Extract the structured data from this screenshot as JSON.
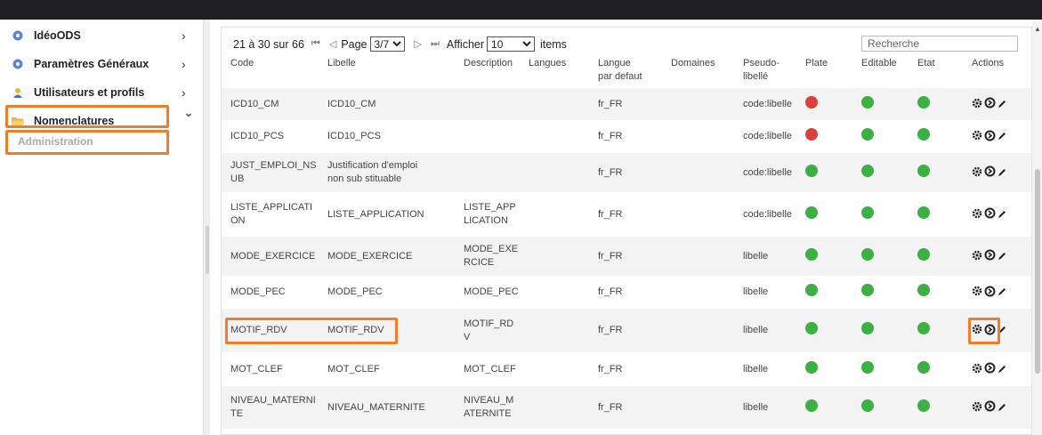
{
  "sidebar": {
    "items": [
      {
        "label": "IdéoODS",
        "icon": "gear-icon",
        "chevron": "›"
      },
      {
        "label": "Paramètres Généraux",
        "icon": "gear-icon",
        "chevron": "›"
      },
      {
        "label": "Utilisateurs et profils",
        "icon": "users-icon",
        "chevron": "›"
      },
      {
        "label": "Nomenclatures",
        "icon": "folder-icon",
        "chevron": "⌄"
      }
    ],
    "sub_item": "Administration"
  },
  "pager": {
    "range_text": "21 à 30 sur 66",
    "page_label": "Page",
    "page_value": "3/7",
    "show_label": "Afficher",
    "show_value": "10",
    "items_label": "items"
  },
  "search": {
    "placeholder": "Recherche"
  },
  "table": {
    "columns": [
      "Code",
      "Libelle",
      "Description",
      "Langues",
      "Langue par defaut",
      "Domaines",
      "Pseudo-libellé",
      "Plate",
      "Editable",
      "Etat",
      "Actions"
    ],
    "rows": [
      {
        "code": "ICD10_CM",
        "libelle": "ICD10_CM",
        "description": "",
        "langues": "",
        "langue_defaut": "fr_FR",
        "domaines": "",
        "pseudo": "code:libelle",
        "plate": "red",
        "editable": "green",
        "etat": "green"
      },
      {
        "code": "ICD10_PCS",
        "libelle": "ICD10_PCS",
        "description": "",
        "langues": "",
        "langue_defaut": "fr_FR",
        "domaines": "",
        "pseudo": "code:libelle",
        "plate": "red",
        "editable": "green",
        "etat": "green"
      },
      {
        "code": "JUST_EMPLOI_NS UB",
        "libelle": "Justification d'emploi non sub stituable",
        "description": "",
        "langues": "",
        "langue_defaut": "fr_FR",
        "domaines": "",
        "pseudo": "code:libelle",
        "plate": "green",
        "editable": "green",
        "etat": "green"
      },
      {
        "code": "LISTE_APPLICATI ON",
        "libelle": "LISTE_APPLICATION",
        "description": "LISTE_APP LICATION",
        "langues": "",
        "langue_defaut": "fr_FR",
        "domaines": "",
        "pseudo": "code:libelle",
        "plate": "green",
        "editable": "green",
        "etat": "green"
      },
      {
        "code": "MODE_EXERCICE",
        "libelle": "MODE_EXERCICE",
        "description": "MODE_EXE RCICE",
        "langues": "",
        "langue_defaut": "fr_FR",
        "domaines": "",
        "pseudo": "libelle",
        "plate": "green",
        "editable": "green",
        "etat": "green"
      },
      {
        "code": "MODE_PEC",
        "libelle": "MODE_PEC",
        "description": "MODE_PEC",
        "langues": "",
        "langue_defaut": "fr_FR",
        "domaines": "",
        "pseudo": "libelle",
        "plate": "green",
        "editable": "green",
        "etat": "green"
      },
      {
        "code": "MOTIF_RDV",
        "libelle": "MOTIF_RDV",
        "description": "MOTIF_RD V",
        "langues": "",
        "langue_defaut": "fr_FR",
        "domaines": "",
        "pseudo": "libelle",
        "plate": "green",
        "editable": "green",
        "etat": "green"
      },
      {
        "code": "MOT_CLEF",
        "libelle": "MOT_CLEF",
        "description": "MOT_CLEF",
        "langues": "",
        "langue_defaut": "fr_FR",
        "domaines": "",
        "pseudo": "libelle",
        "plate": "green",
        "editable": "green",
        "etat": "green"
      },
      {
        "code": "NIVEAU_MATERNI TE",
        "libelle": "NIVEAU_MATERNITE",
        "description": "NIVEAU_M ATERNITE",
        "langues": "",
        "langue_defaut": "fr_FR",
        "domaines": "",
        "pseudo": "libelle",
        "plate": "green",
        "editable": "green",
        "etat": "green"
      }
    ],
    "actions": [
      "gear-icon",
      "arrow-circle-icon",
      "pencil-icon"
    ]
  },
  "colors": {
    "highlight": "#f07d2a",
    "status_green": "#3cb043",
    "status_red": "#d9423c",
    "topbar": "#1e1e24"
  }
}
